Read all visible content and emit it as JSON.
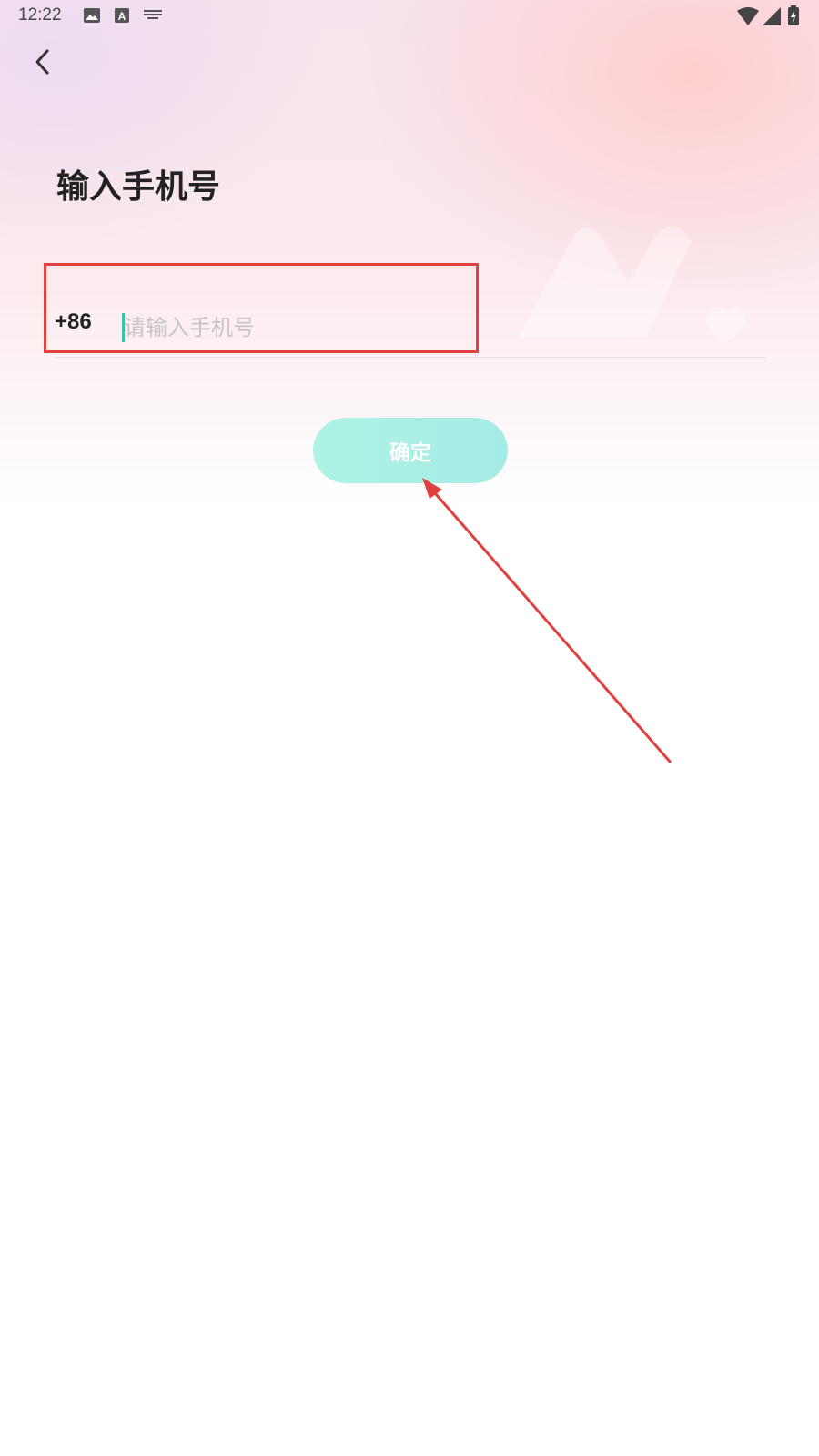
{
  "status_bar": {
    "time": "12:22",
    "left_icons": [
      "image-icon",
      "text-a-icon",
      "keyboard-icon"
    ],
    "right_icons": [
      "wifi-icon",
      "cellular-icon",
      "battery-charging-icon"
    ]
  },
  "nav": {
    "back_icon": "chevron-left-icon"
  },
  "page": {
    "title": "输入手机号"
  },
  "phone": {
    "country_code": "+86",
    "value": "",
    "placeholder": "请输入手机号"
  },
  "confirm": {
    "label": "确定"
  },
  "colors": {
    "accent": "#3fc2a3",
    "button_start": "#aef3e4",
    "button_end": "#a6ece6",
    "annotation": "#e04040"
  }
}
